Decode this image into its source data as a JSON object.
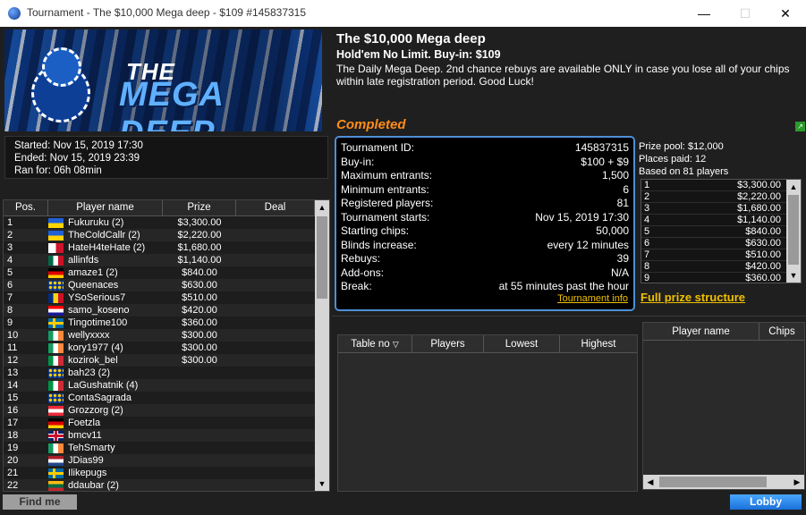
{
  "window": {
    "title": "Tournament - The $10,000 Mega deep - $109 #145837315",
    "minimize": "—",
    "maximize": "☐",
    "close": "✕"
  },
  "banner": {
    "line1": "THE",
    "line2": "MEGA DEEP"
  },
  "header": {
    "title": "The $10,000 Mega deep",
    "subtitle": "Hold'em No Limit. Buy-in: $109",
    "description": "The Daily Mega Deep. 2nd chance rebuys are available ONLY in case you lose all of your chips within late registration period. Good Luck!",
    "status": "Completed",
    "status_color": "#ff8c1a"
  },
  "times": {
    "started": "Started: Nov 15, 2019 17:30",
    "ended": "Ended: Nov 15, 2019 23:39",
    "ran": "Ran for: 06h 08min"
  },
  "info": {
    "rows": [
      {
        "label": "Tournament ID:",
        "value": "145837315"
      },
      {
        "label": "Buy-in:",
        "value": "$100 + $9"
      },
      {
        "label": "Maximum entrants:",
        "value": "1,500"
      },
      {
        "label": "Minimum entrants:",
        "value": "6"
      },
      {
        "label": "Registered players:",
        "value": "81"
      },
      {
        "label": "Tournament starts:",
        "value": "Nov 15, 2019 17:30"
      },
      {
        "label": "Starting chips:",
        "value": "50,000"
      },
      {
        "label": "Blinds increase:",
        "value": "every 12 minutes"
      },
      {
        "label": "Rebuys:",
        "value": "39"
      },
      {
        "label": "Add-ons:",
        "value": "N/A"
      },
      {
        "label": "Break:",
        "value": "at 55 minutes past the hour"
      }
    ],
    "link": "Tournament info"
  },
  "prize": {
    "pool": "Prize pool: $12,000",
    "places": "Places paid: 12",
    "based": "Based on 81 players",
    "list": [
      {
        "pos": "1",
        "amount": "$3,300.00"
      },
      {
        "pos": "2",
        "amount": "$2,220.00"
      },
      {
        "pos": "3",
        "amount": "$1,680.00"
      },
      {
        "pos": "4",
        "amount": "$1,140.00"
      },
      {
        "pos": "5",
        "amount": "$840.00"
      },
      {
        "pos": "6",
        "amount": "$630.00"
      },
      {
        "pos": "7",
        "amount": "$510.00"
      },
      {
        "pos": "8",
        "amount": "$420.00"
      },
      {
        "pos": "9",
        "amount": "$360.00"
      }
    ],
    "full_link": "Full prize structure"
  },
  "players": {
    "headers": [
      "Pos.",
      "Player name",
      "Prize",
      "Deal"
    ],
    "rows": [
      {
        "pos": "1",
        "flag": "ua",
        "name": "Fukuruku (2)",
        "prize": "$3,300.00"
      },
      {
        "pos": "2",
        "flag": "ua",
        "name": "TheColdCallr (2)",
        "prize": "$2,220.00"
      },
      {
        "pos": "3",
        "flag": "mt",
        "name": "HateH4teHate (2)",
        "prize": "$1,680.00"
      },
      {
        "pos": "4",
        "flag": "mx",
        "name": "allinfds",
        "prize": "$1,140.00"
      },
      {
        "pos": "5",
        "flag": "de",
        "name": "amaze1 (2)",
        "prize": "$840.00"
      },
      {
        "pos": "6",
        "flag": "eu",
        "name": "Queenaces",
        "prize": "$630.00"
      },
      {
        "pos": "7",
        "flag": "ro",
        "name": "YSoSerious7",
        "prize": "$510.00"
      },
      {
        "pos": "8",
        "flag": "hr",
        "name": "samo_koseno",
        "prize": "$420.00"
      },
      {
        "pos": "9",
        "flag": "se",
        "name": "Tingotime100",
        "prize": "$360.00"
      },
      {
        "pos": "10",
        "flag": "ie",
        "name": "wellyxxxx",
        "prize": "$300.00"
      },
      {
        "pos": "11",
        "flag": "ie",
        "name": "kory1977 (4)",
        "prize": "$300.00"
      },
      {
        "pos": "12",
        "flag": "it",
        "name": "kozirok_bel",
        "prize": "$300.00"
      },
      {
        "pos": "13",
        "flag": "eu",
        "name": "bah23 (2)",
        "prize": ""
      },
      {
        "pos": "14",
        "flag": "it",
        "name": "LaGushatnik (4)",
        "prize": ""
      },
      {
        "pos": "15",
        "flag": "eu",
        "name": "ContaSagrada",
        "prize": ""
      },
      {
        "pos": "16",
        "flag": "at",
        "name": "Grozzorg (2)",
        "prize": ""
      },
      {
        "pos": "17",
        "flag": "de",
        "name": "Foetzla",
        "prize": ""
      },
      {
        "pos": "18",
        "flag": "gb",
        "name": "bmcv11",
        "prize": ""
      },
      {
        "pos": "19",
        "flag": "ie",
        "name": "TehSmarty",
        "prize": ""
      },
      {
        "pos": "20",
        "flag": "nl",
        "name": "JDias99",
        "prize": ""
      },
      {
        "pos": "21",
        "flag": "se",
        "name": "Ilikepugs",
        "prize": ""
      },
      {
        "pos": "22",
        "flag": "lt",
        "name": "ddaubar (2)",
        "prize": ""
      }
    ]
  },
  "tables": {
    "headers": [
      "Table no",
      "Players",
      "Lowest",
      "Highest"
    ]
  },
  "chipsgrid": {
    "headers": [
      "Player name",
      "Chips"
    ]
  },
  "buttons": {
    "find_me": "Find me",
    "lobby": "Lobby"
  },
  "colors": {
    "accent": "#4d8fd6",
    "link": "#f0c000",
    "lobby": "#1a6fd8"
  }
}
